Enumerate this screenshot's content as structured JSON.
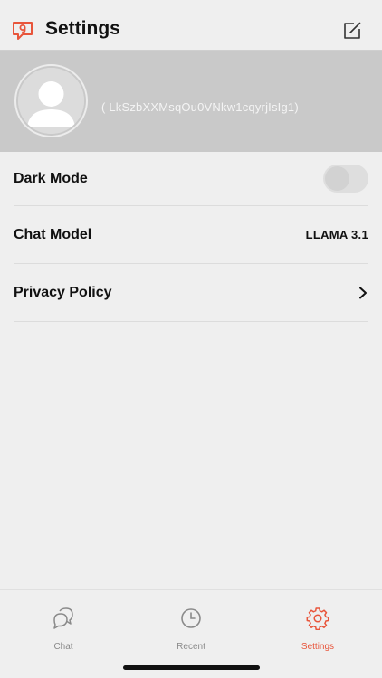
{
  "header": {
    "title": "Settings",
    "logo_icon": "chat-logo-icon",
    "compose_icon": "compose-icon",
    "accent": "#e8553b"
  },
  "profile": {
    "avatar_icon": "user-avatar-icon",
    "user_id": "( LkSzbXXMsqOu0VNkw1cqyrjIsIg1)"
  },
  "settings": {
    "dark_mode": {
      "label": "Dark Mode",
      "enabled": false
    },
    "chat_model": {
      "label": "Chat Model",
      "value": "LLAMA 3.1"
    },
    "privacy_policy": {
      "label": "Privacy Policy",
      "icon": "chevron-right-icon"
    }
  },
  "tabbar": {
    "tabs": [
      {
        "label": "Chat",
        "icon": "chat-bubble-icon",
        "active": false
      },
      {
        "label": "Recent",
        "icon": "clock-icon",
        "active": false
      },
      {
        "label": "Settings",
        "icon": "gear-icon",
        "active": true
      }
    ],
    "active_color": "#e8553b",
    "inactive_color": "#8a8a8a"
  }
}
